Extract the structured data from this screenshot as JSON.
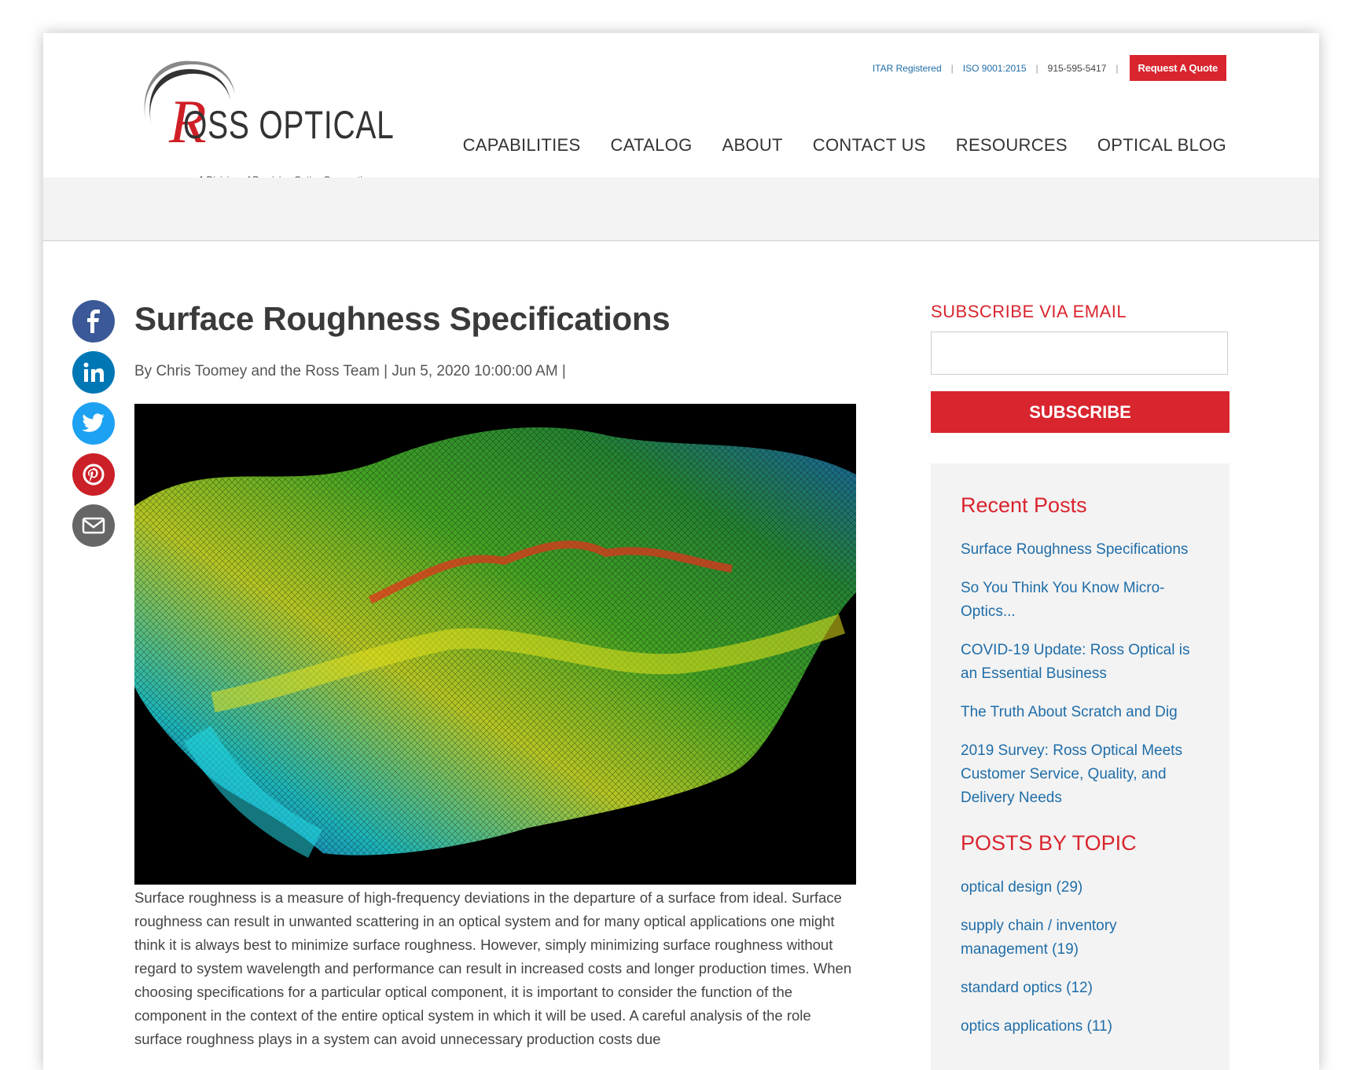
{
  "header": {
    "logo_text": "OSS OPTICAL",
    "logo_letter": "R",
    "logo_tagline": "A Division of Precision Optics Corporation",
    "utility_links": [
      "ITAR Registered",
      "ISO 9001:2015"
    ],
    "phone": "915-595-5417",
    "quote_button": "Request A Quote",
    "nav": [
      "CAPABILITIES",
      "CATALOG",
      "ABOUT",
      "CONTACT US",
      "RESOURCES",
      "OPTICAL BLOG"
    ]
  },
  "share_icons": [
    "facebook-icon",
    "linkedin-icon",
    "twitter-icon",
    "pinterest-icon",
    "email-icon"
  ],
  "share_colors": [
    "#3b5998",
    "#0077b5",
    "#1da1f2",
    "#cb2027",
    "#666666"
  ],
  "article": {
    "title": "Surface Roughness Specifications",
    "byline": "By Chris Toomey and the Ross Team | Jun 5, 2020 10:00:00 AM |",
    "body": "Surface roughness is a measure of high-frequency deviations in the departure of a surface from ideal. Surface roughness can result in unwanted scattering in an optical system and for many optical applications one might think it is always best to minimize surface roughness. However, simply minimizing surface roughness without regard to system wavelength and performance can result in increased costs and longer production times. When choosing specifications for a particular optical component, it is important to consider the function of the component in the context of the entire optical system in which it will be used. A careful analysis of the role surface roughness plays in a system can avoid unnecessary production costs due"
  },
  "sidebar": {
    "subscribe_heading": "SUBSCRIBE VIA EMAIL",
    "subscribe_placeholder": "",
    "subscribe_button": "SUBSCRIBE",
    "recent_heading": "Recent Posts",
    "recent_posts": [
      "Surface Roughness Specifications",
      "So You Think You Know Micro-Optics...",
      "COVID-19 Update: Ross Optical is an Essential Business",
      "The Truth About Scratch and Dig",
      "2019 Survey: Ross Optical Meets Customer Service, Quality, and Delivery Needs"
    ],
    "topics_heading": "POSTS BY TOPIC",
    "topics": [
      "optical design (29)",
      "supply chain / inventory management (19)",
      "standard optics (12)",
      "optics applications (11)"
    ]
  },
  "colors": {
    "accent": "#d9252e",
    "link": "#1f6da8"
  }
}
